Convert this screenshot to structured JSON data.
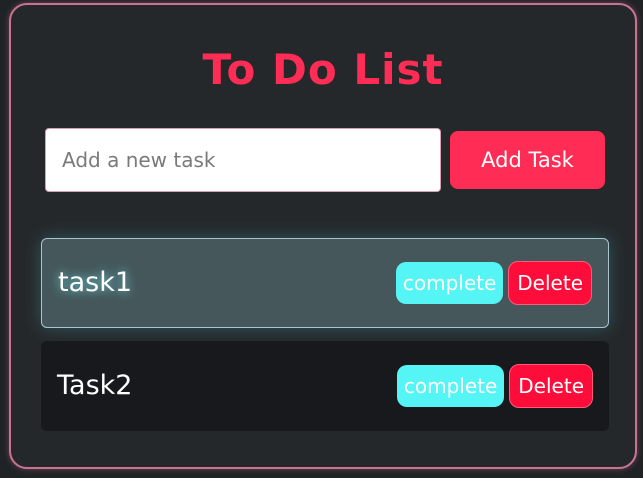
{
  "app": {
    "title": "To Do List"
  },
  "input": {
    "placeholder": "Add a new task",
    "value": ""
  },
  "add_button": {
    "label": "Add Task"
  },
  "tasks": [
    {
      "label": "task1",
      "complete_label": "complete",
      "delete_label": "Delete"
    },
    {
      "label": "Task2",
      "complete_label": "complete",
      "delete_label": "Delete"
    }
  ],
  "colors": {
    "accent": "#ff2d55",
    "complete": "#55f5f5",
    "delete": "#ff0d3a",
    "card_background": "#25282b",
    "highlight_row": "#45575a"
  }
}
